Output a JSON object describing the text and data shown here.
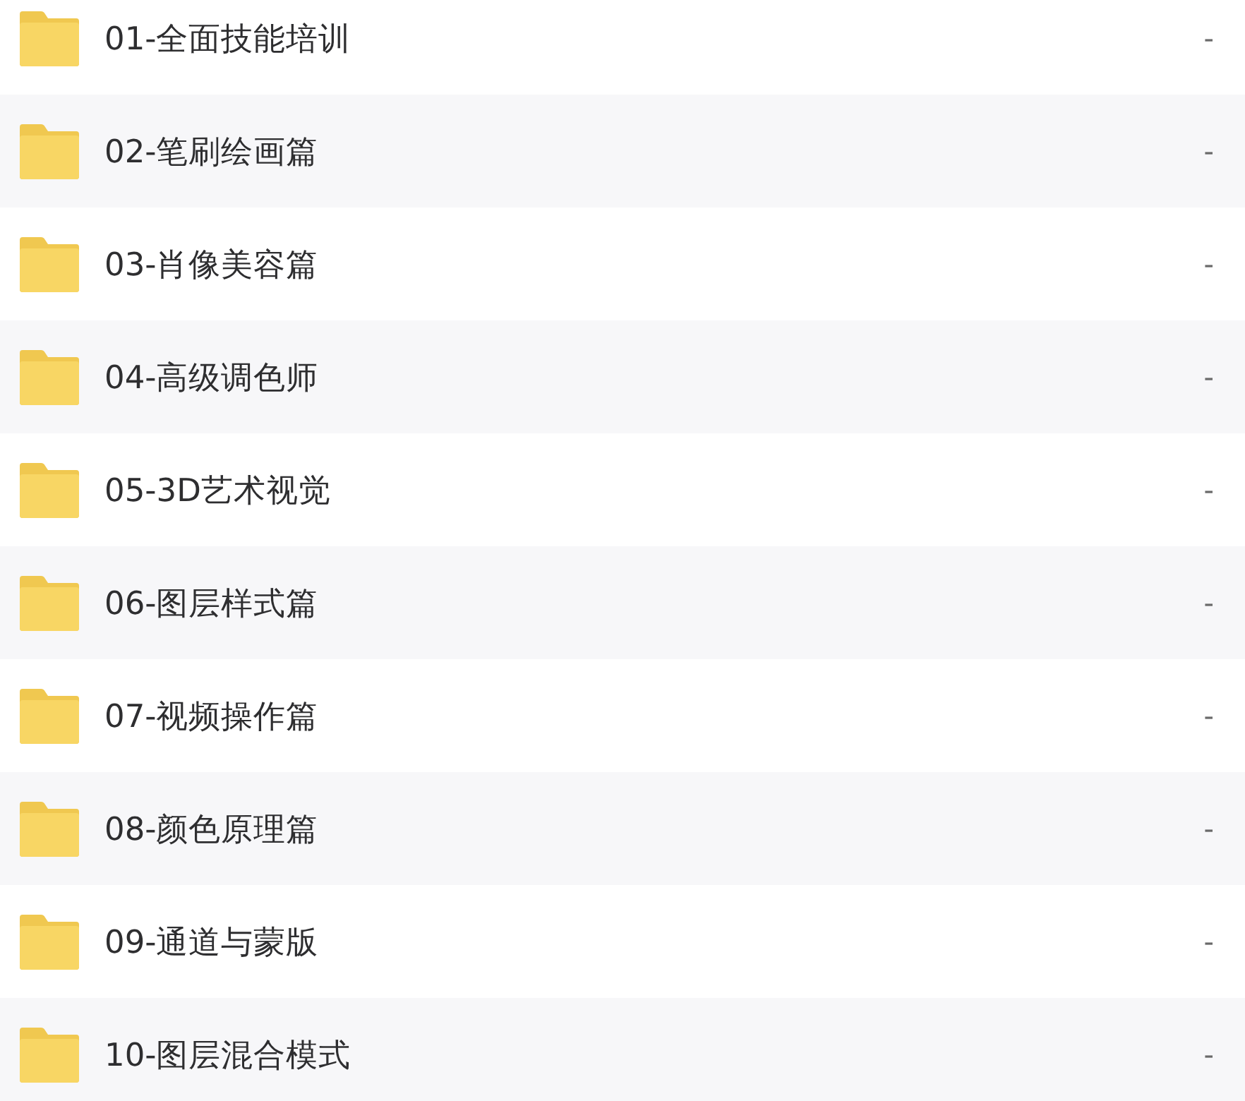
{
  "files": [
    {
      "name": "01-全面技能培训",
      "column_2": "-"
    },
    {
      "name": "02-笔刷绘画篇",
      "column_2": "-"
    },
    {
      "name": "03-肖像美容篇",
      "column_2": "-"
    },
    {
      "name": "04-高级调色师",
      "column_2": "-"
    },
    {
      "name": "05-3D艺术视觉",
      "column_2": "-"
    },
    {
      "name": "06-图层样式篇",
      "column_2": "-"
    },
    {
      "name": "07-视频操作篇",
      "column_2": "-"
    },
    {
      "name": "08-颜色原理篇",
      "column_2": "-"
    },
    {
      "name": "09-通道与蒙版",
      "column_2": "-"
    },
    {
      "name": "10-图层混合模式",
      "column_2": "-"
    }
  ]
}
